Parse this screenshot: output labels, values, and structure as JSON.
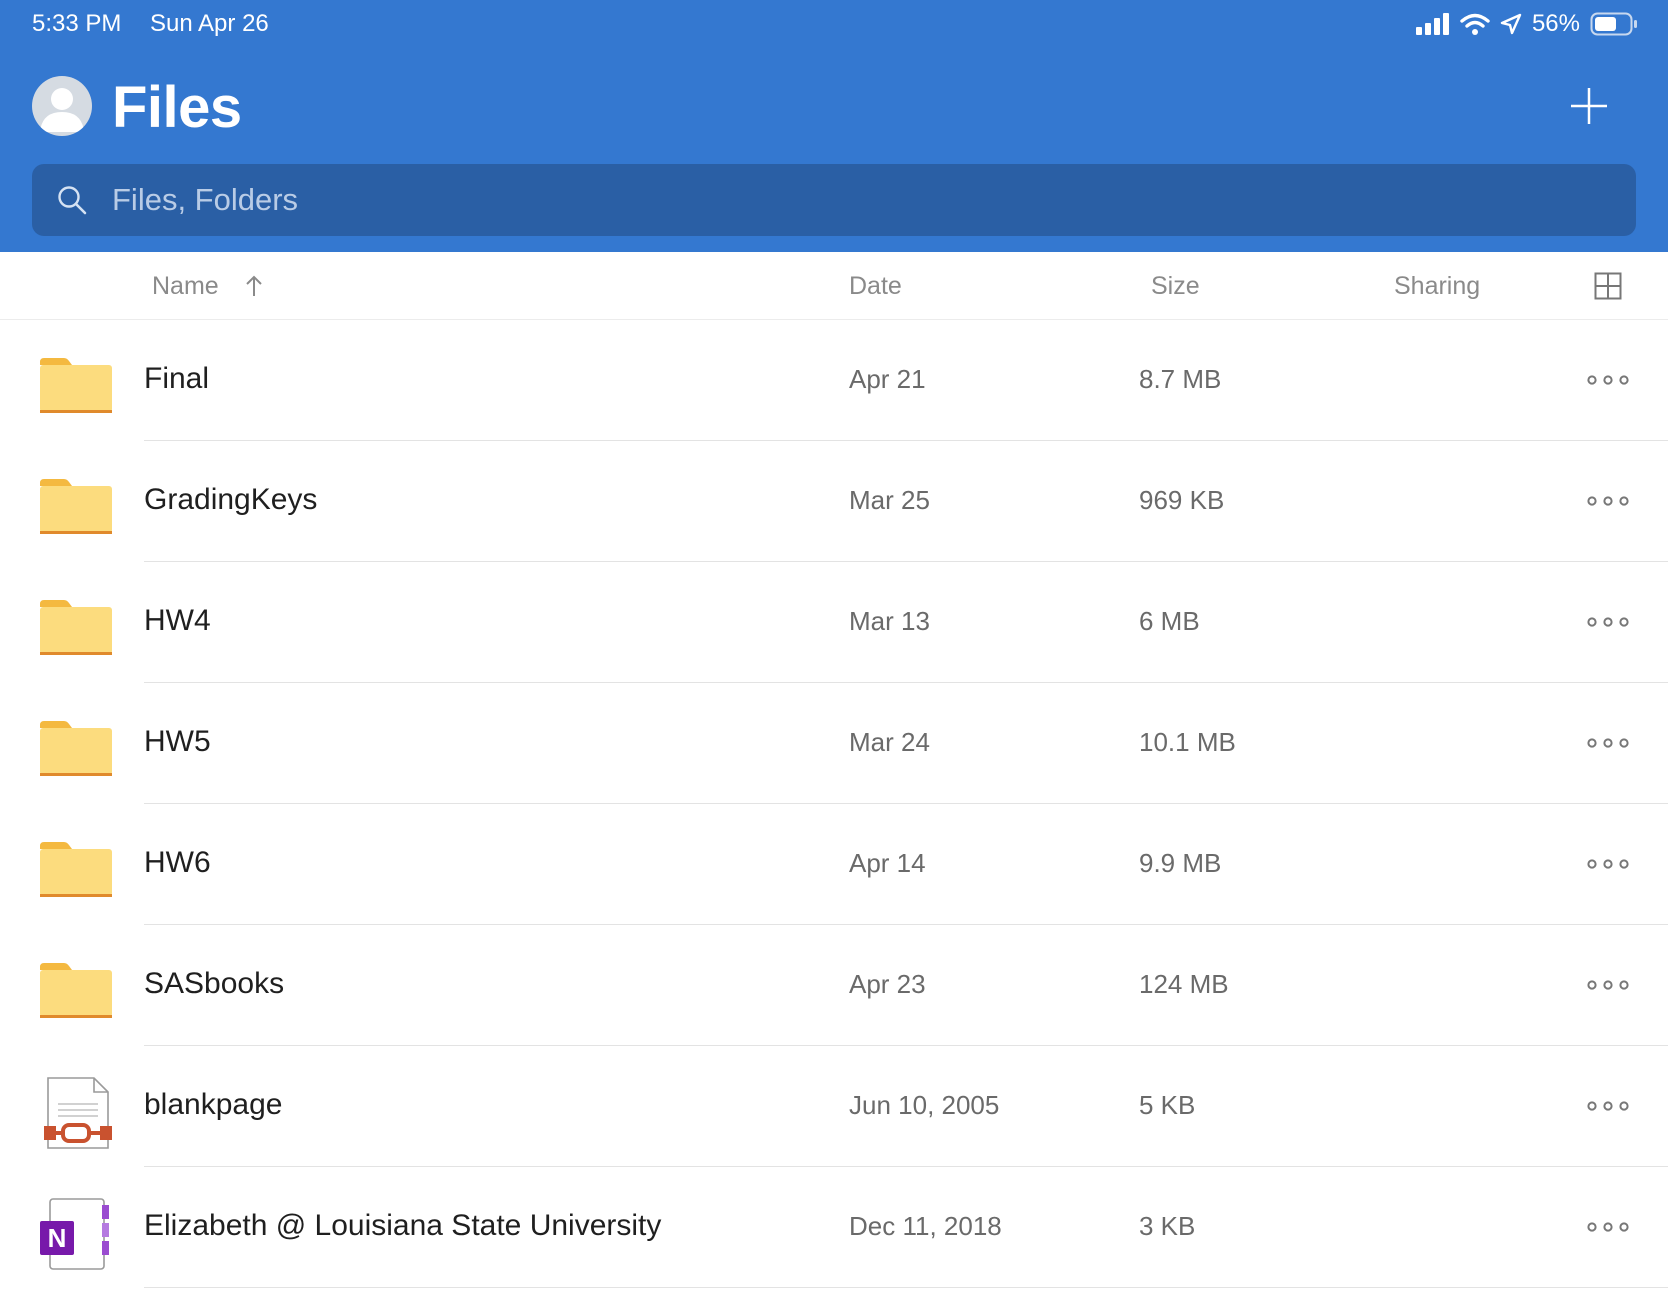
{
  "status_bar": {
    "time": "5:33 PM",
    "date": "Sun Apr 26",
    "battery_percent": "56%",
    "icons": [
      "cellular-signal-icon",
      "wifi-icon",
      "location-arrow-icon",
      "battery-icon"
    ]
  },
  "header": {
    "title": "Files",
    "avatar_icon": "person-avatar-icon",
    "add_icon": "plus-icon"
  },
  "search": {
    "placeholder": "Files, Folders",
    "icon": "search-icon"
  },
  "columns": {
    "name": "Name",
    "date": "Date",
    "size": "Size",
    "sharing": "Sharing",
    "sort_icon": "arrow-up-icon",
    "view_toggle_icon": "grid-view-icon"
  },
  "files": [
    {
      "name": "Final",
      "date": "Apr 21",
      "size": "8.7 MB",
      "type": "folder"
    },
    {
      "name": "GradingKeys",
      "date": "Mar 25",
      "size": "969 KB",
      "type": "folder"
    },
    {
      "name": "HW4",
      "date": "Mar 13",
      "size": "6 MB",
      "type": "folder"
    },
    {
      "name": "HW5",
      "date": "Mar 24",
      "size": "10.1 MB",
      "type": "folder"
    },
    {
      "name": "HW6",
      "date": "Apr 14",
      "size": "9.9 MB",
      "type": "folder"
    },
    {
      "name": "SASbooks",
      "date": "Apr 23",
      "size": "124 MB",
      "type": "folder"
    },
    {
      "name": "blankpage",
      "date": "Jun 10, 2005",
      "size": "5 KB",
      "type": "powerpoint"
    },
    {
      "name": "Elizabeth @ Louisiana State University",
      "date": "Dec 11, 2018",
      "size": "3 KB",
      "type": "onenote",
      "badge_letter": "N"
    }
  ],
  "colors": {
    "header_bg": "#3478d0",
    "search_bg": "#2a5fa5",
    "folder_body": "#fcdc7e",
    "folder_tab": "#f4b940",
    "folder_edge": "#e08a2c",
    "powerpoint": "#c9522f",
    "onenote": "#7719aa"
  }
}
